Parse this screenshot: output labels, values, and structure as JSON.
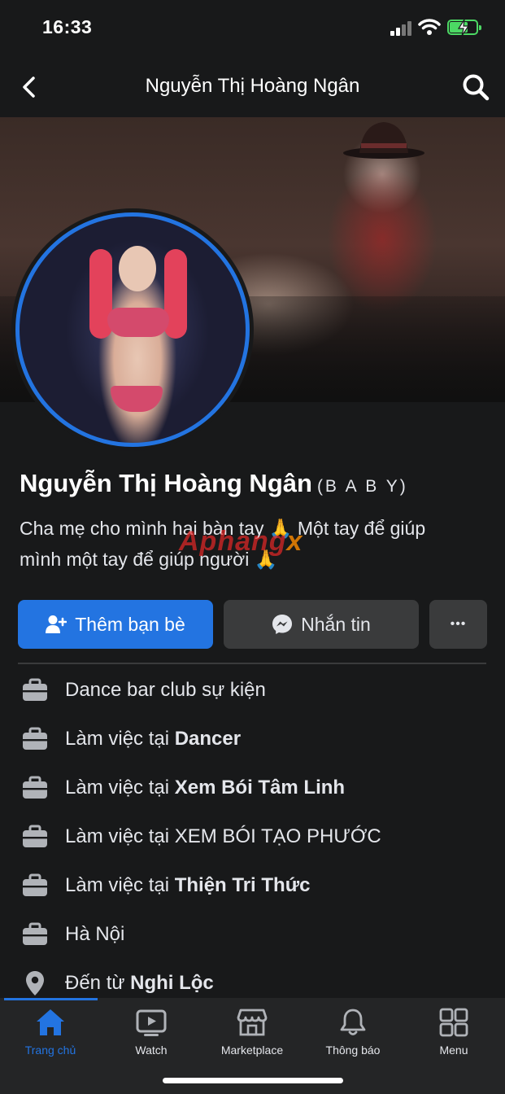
{
  "status_bar": {
    "time": "16:33",
    "battery_level": 0.7
  },
  "nav": {
    "title": "Nguyễn Thị Hoàng Ngân",
    "back_icon": "chevron-left-icon",
    "search_icon": "search-icon"
  },
  "profile": {
    "name": "Nguyễn Thị Hoàng Ngân",
    "alternate_name": "(B A B Y)",
    "bio_line1": "Cha mẹ cho mình hai bàn tay 🙏 Một tay để giúp",
    "bio_line2": "mình một tay để giúp người 🙏",
    "watermark": "Aphang",
    "watermark_suffix": "x"
  },
  "actions": {
    "add_friend_label": "Thêm bạn bè",
    "message_label": "Nhắn tin",
    "more_label": "•••"
  },
  "details": [
    {
      "icon": "briefcase-icon",
      "prefix": "Dance bar club sự kiện",
      "bold": ""
    },
    {
      "icon": "briefcase-icon",
      "prefix": "Làm việc tại ",
      "bold": "Dancer"
    },
    {
      "icon": "briefcase-icon",
      "prefix": "Làm việc tại ",
      "bold": "Xem Bói Tâm Linh"
    },
    {
      "icon": "briefcase-icon",
      "prefix": "Làm việc tại XEM BÓI TẠO PHƯỚC",
      "bold": ""
    },
    {
      "icon": "briefcase-icon",
      "prefix": "Làm việc tại ",
      "bold": "Thiện Tri Thức"
    },
    {
      "icon": "briefcase-icon",
      "prefix": "Hà Nội",
      "bold": ""
    },
    {
      "icon": "location-pin-icon",
      "prefix": "Đến từ ",
      "bold": "Nghi Lộc"
    }
  ],
  "tabs": [
    {
      "label": "Trang chủ",
      "icon": "home-icon",
      "active": true
    },
    {
      "label": "Watch",
      "icon": "video-icon",
      "active": false
    },
    {
      "label": "Marketplace",
      "icon": "shop-icon",
      "active": false
    },
    {
      "label": "Thông báo",
      "icon": "bell-icon",
      "active": false
    },
    {
      "label": "Menu",
      "icon": "grid-icon",
      "active": false
    }
  ],
  "colors": {
    "accent": "#2374e1",
    "background": "#18191a",
    "secondary_button": "#3a3b3c",
    "battery": "#4cd964"
  }
}
